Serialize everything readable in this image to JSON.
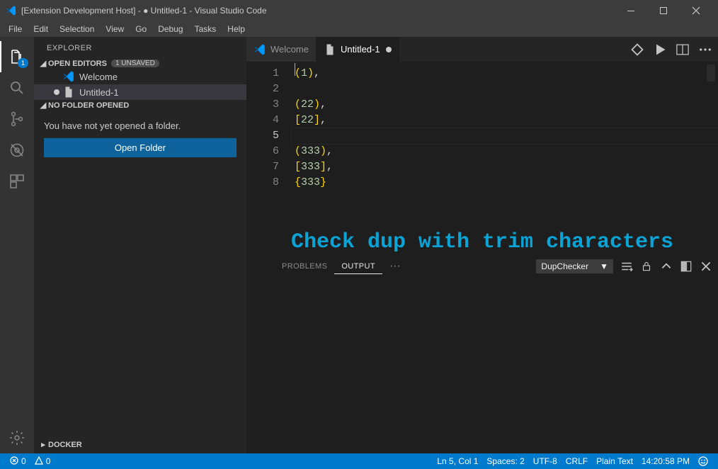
{
  "window_title": "[Extension Development Host] - ● Untitled-1 - Visual Studio Code",
  "menu": [
    "File",
    "Edit",
    "Selection",
    "View",
    "Go",
    "Debug",
    "Tasks",
    "Help"
  ],
  "activity_badge": "1",
  "sidebar": {
    "title": "EXPLORER",
    "open_editors_label": "OPEN EDITORS",
    "unsaved_count_label": "1 UNSAVED",
    "items": [
      {
        "label": "Welcome",
        "dirty": false,
        "icon": "vscode"
      },
      {
        "label": "Untitled-1",
        "dirty": true,
        "icon": "file"
      }
    ],
    "no_folder_label": "NO FOLDER OPENED",
    "no_folder_msg": "You have not yet opened a folder.",
    "open_folder_btn": "Open Folder",
    "docker_label": "DOCKER"
  },
  "tabs": [
    {
      "label": "Welcome",
      "icon": "vscode",
      "active": false,
      "dirty": false
    },
    {
      "label": "Untitled-1",
      "icon": "file",
      "active": true,
      "dirty": true
    }
  ],
  "code_lines": [
    {
      "n": "1",
      "text": "(1),"
    },
    {
      "n": "2",
      "text": ""
    },
    {
      "n": "3",
      "text": "(22),"
    },
    {
      "n": "4",
      "text": "[22],"
    },
    {
      "n": "5",
      "text": ""
    },
    {
      "n": "6",
      "text": "(333),"
    },
    {
      "n": "7",
      "text": "[333],"
    },
    {
      "n": "8",
      "text": "{333}"
    }
  ],
  "current_line_index": 4,
  "overlay_text": "Check dup with trim characters",
  "panel": {
    "tabs": {
      "problems": "PROBLEMS",
      "output": "OUTPUT"
    },
    "dropdown": "DupChecker"
  },
  "status": {
    "errors": "0",
    "warnings": "0",
    "ln_col": "Ln 5, Col 1",
    "spaces": "Spaces: 2",
    "encoding": "UTF-8",
    "eol": "CRLF",
    "lang": "Plain Text",
    "time": "14:20:58 PM"
  },
  "colors": {
    "accent": "#007acc",
    "heading": "#0aa3d6"
  }
}
